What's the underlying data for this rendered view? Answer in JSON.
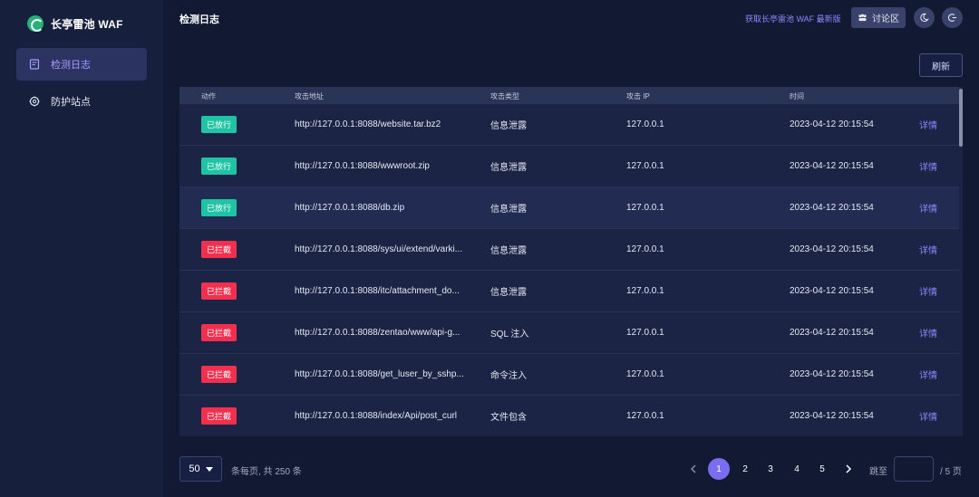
{
  "app": {
    "name": "长亭雷池 WAF"
  },
  "sidebar": {
    "items": [
      {
        "label": "检测日志",
        "icon": "log-icon",
        "active": true
      },
      {
        "label": "防护站点",
        "icon": "site-shield-icon",
        "active": false
      }
    ]
  },
  "header": {
    "title": "检测日志",
    "get_latest": "获取长亭雷池 WAF 最新版",
    "discuss_label": "讨论区",
    "theme_icon": "moon-icon",
    "logout_icon": "logout-icon"
  },
  "toolbar": {
    "refresh_label": "刷新"
  },
  "table": {
    "columns": [
      "动作",
      "攻击地址",
      "攻击类型",
      "攻击 IP",
      "时间"
    ],
    "detail_label": "详情",
    "rows": [
      {
        "action": "已放行",
        "status": "pass",
        "url": "http://127.0.0.1:8088/website.tar.bz2",
        "type": "信息泄露",
        "ip": "127.0.0.1",
        "time": "2023-04-12 20:15:54"
      },
      {
        "action": "已放行",
        "status": "pass",
        "url": "http://127.0.0.1:8088/wwwroot.zip",
        "type": "信息泄露",
        "ip": "127.0.0.1",
        "time": "2023-04-12 20:15:54"
      },
      {
        "action": "已放行",
        "status": "pass",
        "url": "http://127.0.0.1:8088/db.zip",
        "type": "信息泄露",
        "ip": "127.0.0.1",
        "time": "2023-04-12 20:15:54"
      },
      {
        "action": "已拦截",
        "status": "block",
        "url": "http://127.0.0.1:8088/sys/ui/extend/varki...",
        "type": "信息泄露",
        "ip": "127.0.0.1",
        "time": "2023-04-12 20:15:54"
      },
      {
        "action": "已拦截",
        "status": "block",
        "url": "http://127.0.0.1:8088/itc/attachment_do...",
        "type": "信息泄露",
        "ip": "127.0.0.1",
        "time": "2023-04-12 20:15:54"
      },
      {
        "action": "已拦截",
        "status": "block",
        "url": "http://127.0.0.1:8088/zentao/www/api-g...",
        "type": "SQL 注入",
        "ip": "127.0.0.1",
        "time": "2023-04-12 20:15:54"
      },
      {
        "action": "已拦截",
        "status": "block",
        "url": "http://127.0.0.1:8088/get_luser_by_sshp...",
        "type": "命令注入",
        "ip": "127.0.0.1",
        "time": "2023-04-12 20:15:54"
      },
      {
        "action": "已拦截",
        "status": "block",
        "url": "http://127.0.0.1:8088/index/Api/post_curl",
        "type": "文件包含",
        "ip": "127.0.0.1",
        "time": "2023-04-12 20:15:54"
      }
    ]
  },
  "pagination": {
    "page_size": "50",
    "total_text": "条每页, 共 250 条",
    "pages": [
      "1",
      "2",
      "3",
      "4",
      "5"
    ],
    "current_page": "1",
    "jump_label": "跳至",
    "jump_value": "",
    "pages_total": "/ 5 页"
  },
  "colors": {
    "accent": "#7b6cf0",
    "pass": "#1ec4a4",
    "block": "#f0304e",
    "background": "#121a33",
    "sidebar": "#161f3c"
  }
}
